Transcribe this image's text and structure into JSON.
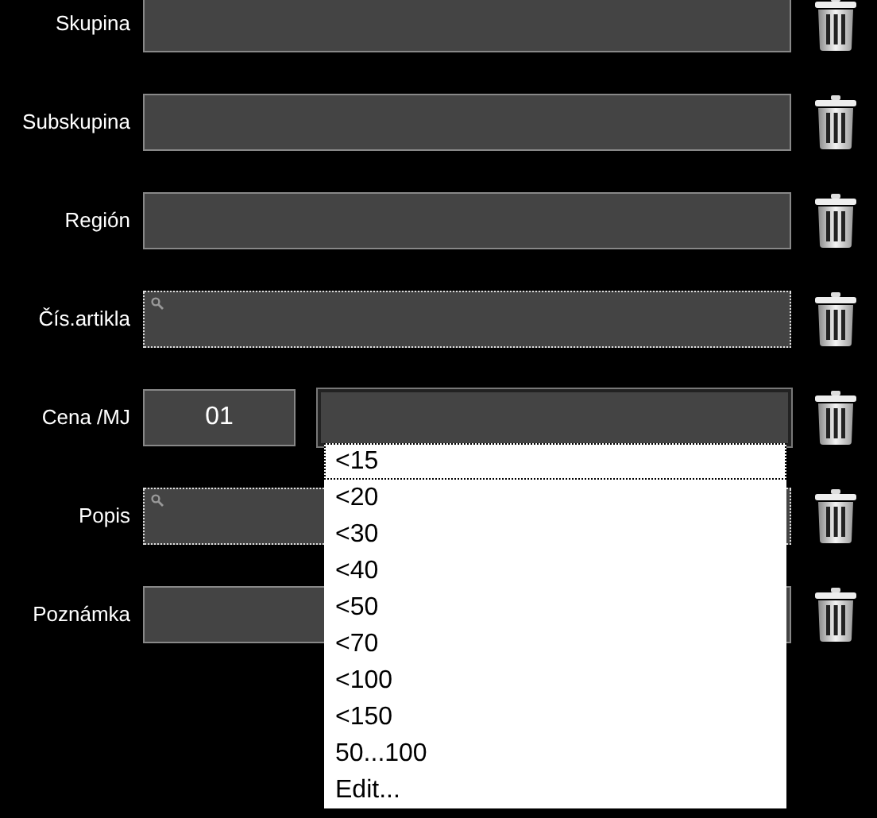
{
  "rows": [
    {
      "label": "Skupina",
      "kind": "text"
    },
    {
      "label": "Subskupina",
      "kind": "text"
    },
    {
      "label": "Región",
      "kind": "text"
    },
    {
      "label": "Čís.artikla",
      "kind": "search"
    },
    {
      "label": "Cena /MJ",
      "kind": "price",
      "code": "01"
    },
    {
      "label": "Popis",
      "kind": "search"
    },
    {
      "label": "Poznámka",
      "kind": "text"
    }
  ],
  "dropdown": {
    "options": [
      {
        "label": "<15",
        "selected": true
      },
      {
        "label": "<20",
        "selected": false
      },
      {
        "label": "<30",
        "selected": false
      },
      {
        "label": "<40",
        "selected": false
      },
      {
        "label": "<50",
        "selected": false
      },
      {
        "label": "<70",
        "selected": false
      },
      {
        "label": "<100",
        "selected": false
      },
      {
        "label": "<150",
        "selected": false
      },
      {
        "label": "50...100",
        "selected": false
      },
      {
        "label": "Edit...",
        "selected": false
      }
    ]
  }
}
